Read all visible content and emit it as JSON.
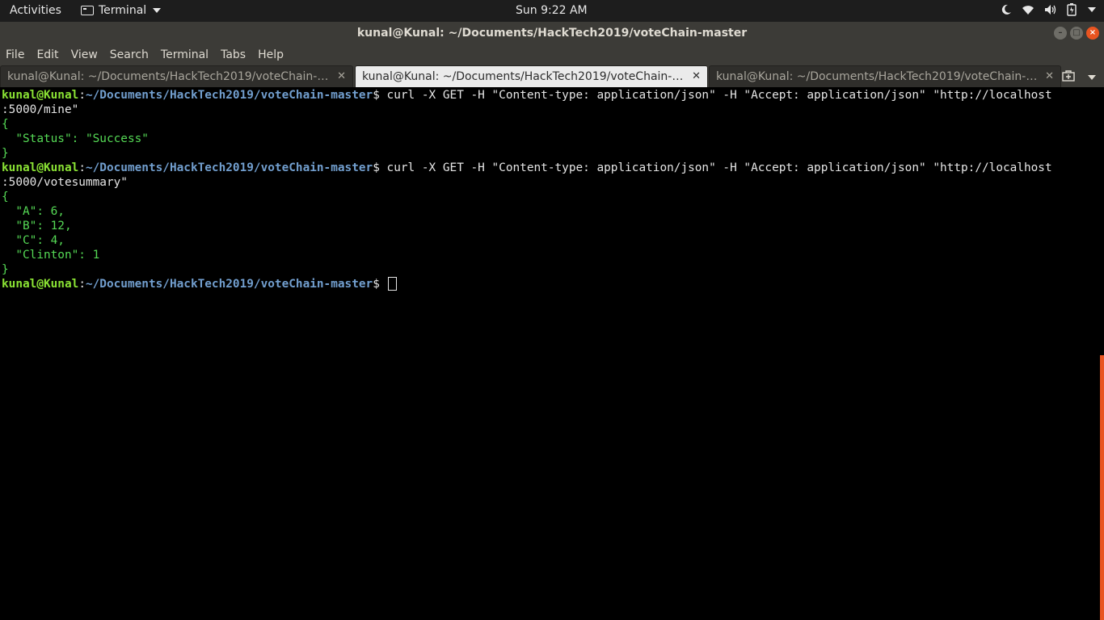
{
  "topbar": {
    "activities": "Activities",
    "app_name": "Terminal",
    "clock": "Sun  9:22 AM"
  },
  "window": {
    "title": "kunal@Kunal: ~/Documents/HackTech2019/voteChain-master"
  },
  "menu": [
    "File",
    "Edit",
    "View",
    "Search",
    "Terminal",
    "Tabs",
    "Help"
  ],
  "tabs": [
    {
      "label": "kunal@Kunal: ~/Documents/HackTech2019/voteChain-ma…"
    },
    {
      "label": "kunal@Kunal: ~/Documents/HackTech2019/voteChain-ma…"
    },
    {
      "label": "kunal@Kunal: ~/Documents/HackTech2019/voteChain-ma…"
    }
  ],
  "terminal": {
    "prompt_user": "kunal@Kunal",
    "prompt_path": "~/Documents/HackTech2019/voteChain-master",
    "prompt_symbol": "$",
    "cmd1_line1": " curl -X GET -H \"Content-type: application/json\" -H \"Accept: application/json\" \"http://localhost",
    "cmd1_line2": ":5000/mine\"",
    "out1": [
      "{",
      "  \"Status\": \"Success\"",
      "}"
    ],
    "cmd2_line1": " curl -X GET -H \"Content-type: application/json\" -H \"Accept: application/json\" \"http://localhost",
    "cmd2_line2": ":5000/votesummary\"",
    "out2": [
      "{",
      "  \"A\": 6,",
      "  \"B\": 12,",
      "  \"C\": 4,",
      "  \"Clinton\": 1",
      "}"
    ]
  },
  "colors": {
    "accent": "#e95420",
    "prompt_user": "#8ae234",
    "prompt_path": "#729fcf",
    "output": "#55d955"
  }
}
